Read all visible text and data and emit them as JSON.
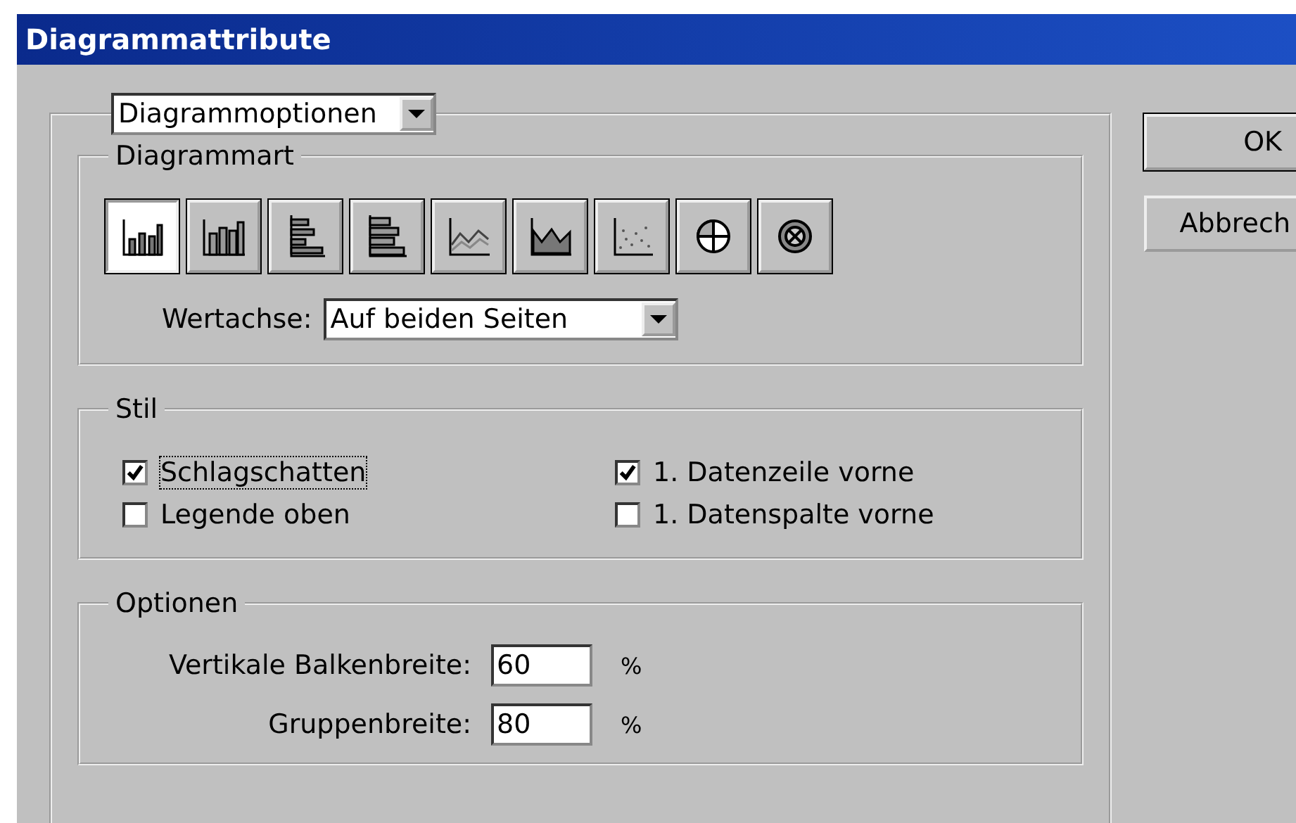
{
  "window": {
    "title": "Diagrammattribute"
  },
  "section_select": {
    "value": "Diagrammoptionen"
  },
  "chart_type": {
    "legend": "Diagrammart",
    "types": [
      {
        "kind": "column",
        "selected": true
      },
      {
        "kind": "stacked-column",
        "selected": false
      },
      {
        "kind": "bar",
        "selected": false
      },
      {
        "kind": "stacked-bar",
        "selected": false
      },
      {
        "kind": "line",
        "selected": false
      },
      {
        "kind": "area",
        "selected": false
      },
      {
        "kind": "scatter",
        "selected": false
      },
      {
        "kind": "pie",
        "selected": false
      },
      {
        "kind": "radar",
        "selected": false
      }
    ],
    "value_axis": {
      "label": "Wertachse:",
      "value": "Auf beiden Seiten"
    }
  },
  "style": {
    "legend": "Stil",
    "options": [
      {
        "label": "Schlagschatten",
        "checked": true,
        "focused": true
      },
      {
        "label": "1. Datenzeile vorne",
        "checked": true,
        "focused": false
      },
      {
        "label": "Legende oben",
        "checked": false,
        "focused": false
      },
      {
        "label": "1. Datenspalte vorne",
        "checked": false,
        "focused": false
      }
    ]
  },
  "options": {
    "legend": "Optionen",
    "fields": [
      {
        "label": "Vertikale Balkenbreite:",
        "value": "60",
        "unit": "%"
      },
      {
        "label": "Gruppenbreite:",
        "value": "80",
        "unit": "%"
      }
    ]
  },
  "buttons": [
    {
      "label": "OK",
      "default": true
    },
    {
      "label": "Abbrech",
      "default": false
    }
  ]
}
